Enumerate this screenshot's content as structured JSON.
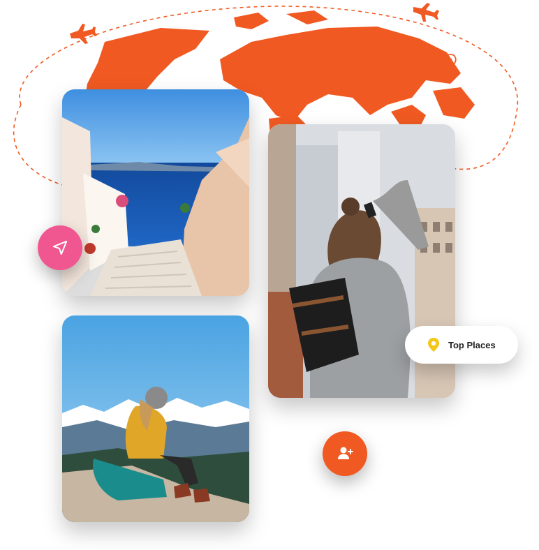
{
  "colors": {
    "map_orange": "#f05a22",
    "send_pink": "#f0568f",
    "pin_yellow": "#f5c518",
    "chip_bg": "#ffffff"
  },
  "icons": {
    "send": "paper-plane-icon",
    "add_user": "user-plus-icon",
    "location": "map-pin-icon",
    "airplane": "airplane-icon"
  },
  "photos": [
    {
      "subject": "santorini-stairs-sea"
    },
    {
      "subject": "traveler-photographing-city"
    },
    {
      "subject": "hiker-mountain-notebook"
    }
  ],
  "top_places": {
    "label": "Top Places"
  }
}
